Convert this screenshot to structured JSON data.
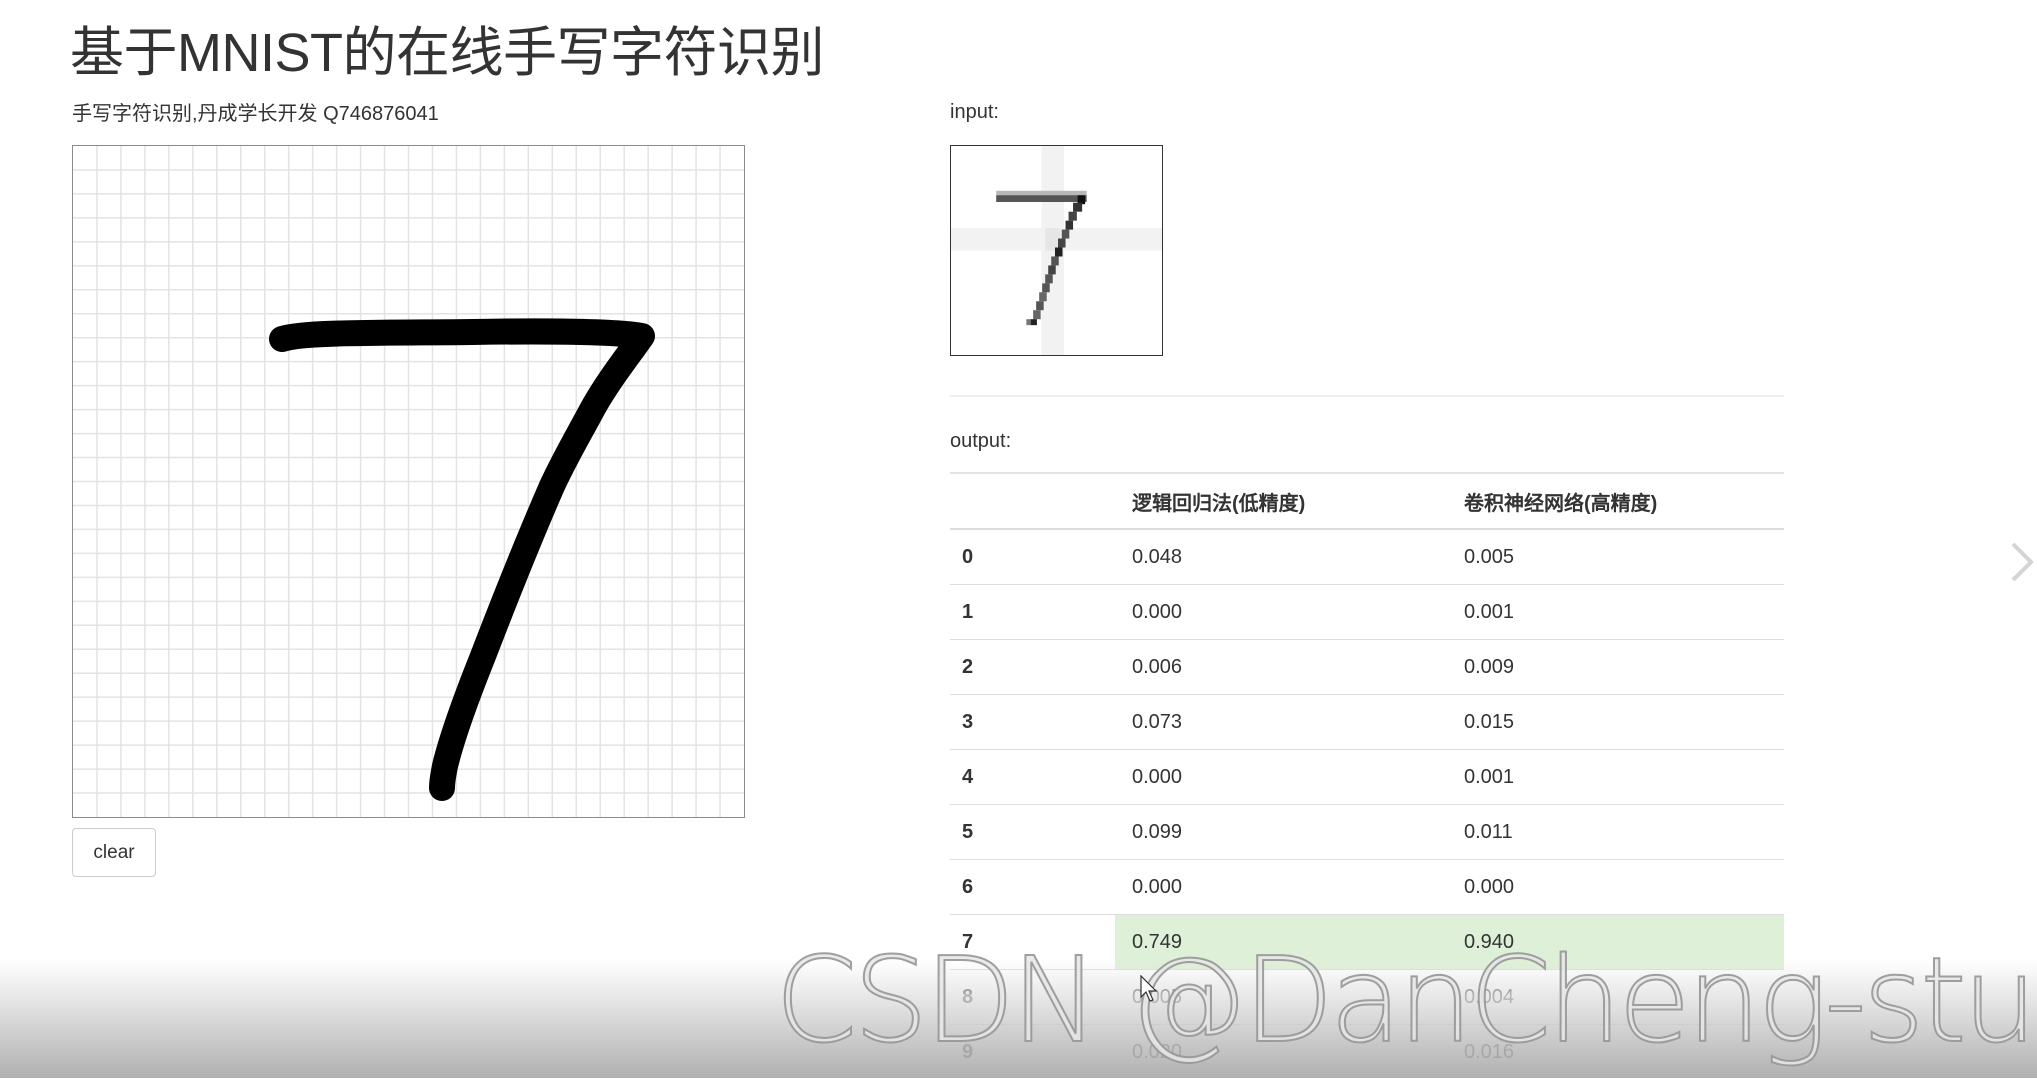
{
  "page": {
    "title": "基于MNIST的在线手写字符识别",
    "subtitle": "手写字符识别,丹成学长开发 Q746876041"
  },
  "drawing_canvas": {
    "grid_cells": 28,
    "drawn_digit": "7"
  },
  "clear_button": {
    "label": "clear"
  },
  "input_section": {
    "label": "input:"
  },
  "output_section": {
    "label": "output:",
    "columns": [
      "",
      "逻辑回归法(低精度)",
      "卷积神经网络(高精度)"
    ],
    "rows": [
      {
        "digit": "0",
        "logistic": "0.048",
        "cnn": "0.005"
      },
      {
        "digit": "1",
        "logistic": "0.000",
        "cnn": "0.001"
      },
      {
        "digit": "2",
        "logistic": "0.006",
        "cnn": "0.009"
      },
      {
        "digit": "3",
        "logistic": "0.073",
        "cnn": "0.015"
      },
      {
        "digit": "4",
        "logistic": "0.000",
        "cnn": "0.001"
      },
      {
        "digit": "5",
        "logistic": "0.099",
        "cnn": "0.011"
      },
      {
        "digit": "6",
        "logistic": "0.000",
        "cnn": "0.000"
      },
      {
        "digit": "7",
        "logistic": "0.749",
        "cnn": "0.940",
        "highlight": true
      },
      {
        "digit": "8",
        "logistic": "0.005",
        "cnn": "0.004"
      },
      {
        "digit": "9",
        "logistic": "0.020",
        "cnn": "0.016"
      }
    ],
    "highlight_color": "#dff0d8"
  },
  "watermark": {
    "text": "CSDN @DanCheng-studio"
  },
  "icons": {
    "next": "chevron-right-icon",
    "cursor": "mouse-pointer-icon"
  }
}
